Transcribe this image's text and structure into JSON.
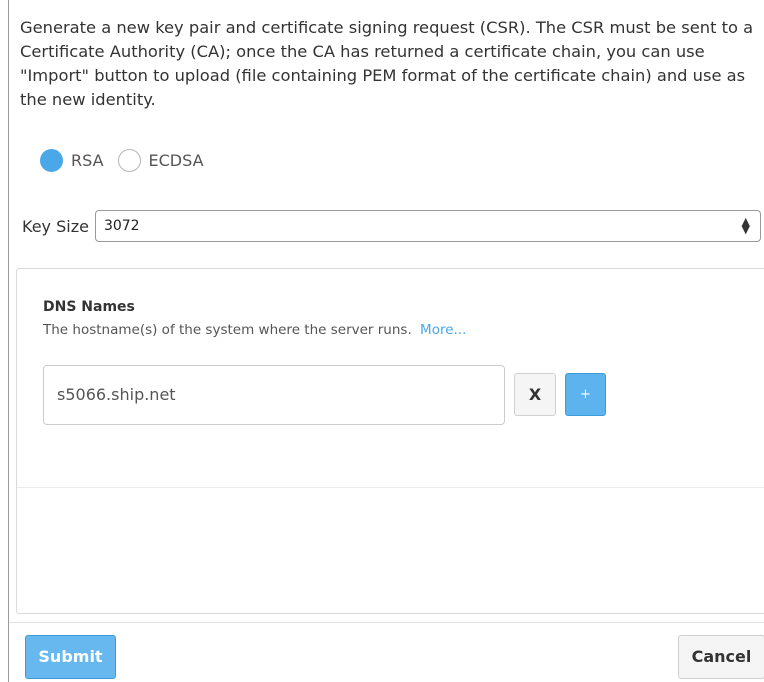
{
  "intro": {
    "text": "Generate a new key pair and certificate signing request (CSR). The CSR must be sent to a Certificate Authority (CA); once the CA has returned a certificate chain, you can use \"Import\" button to upload (file containing PEM format of the certificate chain) and use as the new identity."
  },
  "key_type": {
    "options": [
      {
        "label": "RSA",
        "selected": true
      },
      {
        "label": "ECDSA",
        "selected": false
      }
    ]
  },
  "key_size": {
    "label": "Key Size",
    "value": "3072",
    "arrows": "▲▼"
  },
  "dns": {
    "title": "DNS Names",
    "description": "The hostname(s) of the system where the server runs.",
    "more_link": "More...",
    "entries": [
      "s5066.ship.net"
    ],
    "remove_label": "X",
    "add_label": "+"
  },
  "footer": {
    "submit_label": "Submit",
    "cancel_label": "Cancel"
  },
  "colors": {
    "accent": "#4aa8e8",
    "submit_bg": "#67b8ee",
    "cancel_bg": "#f5f5f5"
  }
}
